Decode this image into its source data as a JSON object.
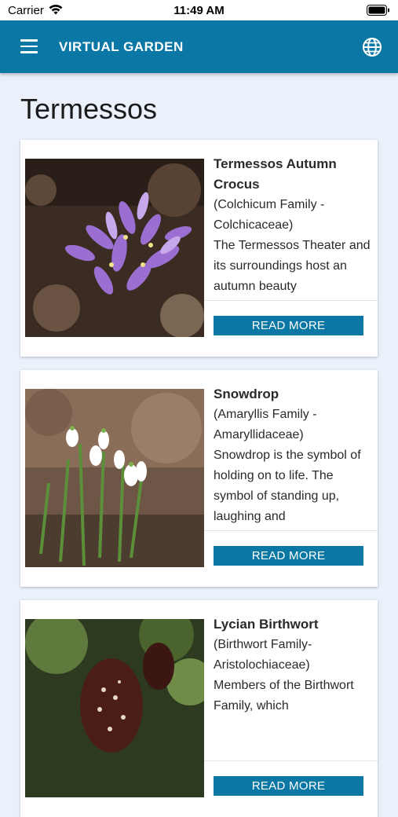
{
  "status_bar": {
    "carrier": "Carrier",
    "time": "11:49 AM"
  },
  "app_bar": {
    "title": "VIRTUAL GARDEN"
  },
  "page": {
    "title": "Termessos"
  },
  "cards": [
    {
      "name": "Termessos Autumn Crocus",
      "family": "(Colchicum Family - Colchicaceae)",
      "description": "The Termessos Theater and its surroundings host an autumn beauty",
      "button": "READ MORE"
    },
    {
      "name": "Snowdrop",
      "family": "(Amaryllis Family - Amaryllidaceae)",
      "description": "Snowdrop is the symbol of holding on to life. The symbol of standing up, laughing and",
      "button": "READ MORE"
    },
    {
      "name": "Lycian Birthwort",
      "family": "(Birthwort Family- Aristolochiaceae)",
      "description": "Members of the Birthwort Family, which",
      "button": "READ MORE"
    }
  ],
  "icons": {
    "menu": "hamburger-menu-icon",
    "language": "globe-icon",
    "wifi": "wifi-icon",
    "battery": "battery-icon"
  },
  "colors": {
    "accent": "#0a77a5",
    "background": "#eaf1fb"
  }
}
